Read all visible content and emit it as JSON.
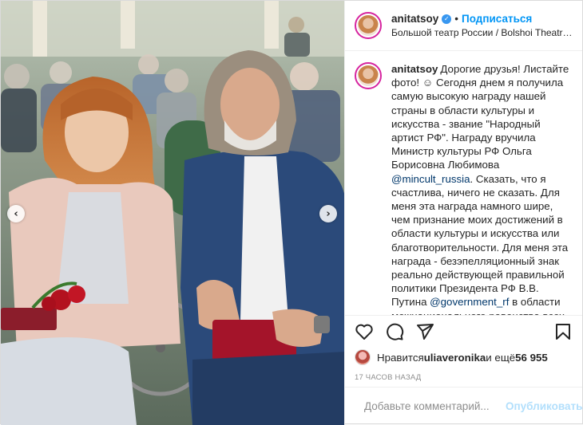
{
  "post": {
    "username": "anitatsoy",
    "follow_label": "Подписаться",
    "separator": "•",
    "location": "Большой театр России / Bolshoi Theatre of R...",
    "caption_text": "Дорогие друзья! Листайте фото! ☺ Сегодня днем я получила самую высокую награду нашей страны в области культуры и искусства - звание \"Народный артист РФ\". Награду вручила Министр культуры РФ Ольга Борисовна Любимова ",
    "mention_1": "@mincult_russia",
    "caption_text_2": ". Сказать, что я счастлива, ничего не сказать. Для меня эта награда намного шире, чем признание моих достижений в области культуры и искусства или благотворительности. Для меня эта награда - безэпелляционный знак реально действующей правильной политики Президента РФ В.В. Путина ",
    "mention_2": "@government_rf",
    "caption_text_3": " в области межнационального равенства всех",
    "likes_prefix": "Нравится ",
    "likes_user": "uliaveronika",
    "likes_mid": " и ещё ",
    "likes_count": "56 955",
    "timestamp": "17 часов назад"
  },
  "comment": {
    "placeholder": "Добавьте комментарий...",
    "publish_label": "Опубликовать"
  },
  "icons": {
    "heart": "heart-icon",
    "comment": "comment-icon",
    "share": "share-icon",
    "save": "bookmark-icon",
    "emoji": "emoji-icon",
    "prev": "chevron-left-icon",
    "next": "chevron-right-icon"
  },
  "colors": {
    "accent": "#0095f6",
    "verified": "#3897f0",
    "publish_disabled": "#b2dffc",
    "muted": "#8e8e8e"
  }
}
